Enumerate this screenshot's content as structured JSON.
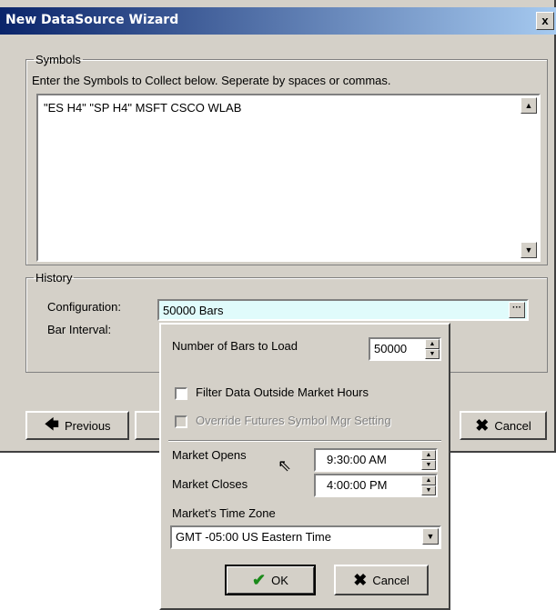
{
  "window": {
    "title": "New DataSource Wizard",
    "close_glyph": "x"
  },
  "symbols": {
    "legend": "Symbols",
    "instructions": "Enter the Symbols to Collect below.  Seperate by spaces or commas.",
    "value": "\"ES H4\" \"SP H4\" MSFT CSCO WLAB"
  },
  "history": {
    "legend": "History",
    "configuration_label": "Configuration:",
    "configuration_value": "50000 Bars",
    "bar_interval_label": "Bar Interval:"
  },
  "buttons": {
    "previous": "Previous",
    "cancel": "Cancel"
  },
  "popup": {
    "bars_label": "Number of Bars to Load",
    "bars_value": "50000",
    "filter_label": "Filter Data Outside Market Hours",
    "filter_checked": false,
    "override_label": "Override Futures Symbol Mgr Setting",
    "override_checked": false,
    "override_enabled": false,
    "market_opens_label": "Market Opens",
    "market_opens_value": "9:30:00 AM",
    "market_closes_label": "Market Closes",
    "market_closes_value": "4:00:00 PM",
    "timezone_label": "Market's Time Zone",
    "timezone_value": "GMT -05:00  US Eastern Time",
    "ok": "OK",
    "cancel": "Cancel"
  },
  "icons": {
    "close": "close-icon",
    "previous": "arrow-left-icon",
    "cancel": "x-icon",
    "ok": "check-icon"
  },
  "colors": {
    "title_gradient_start": "#0a246a",
    "title_gradient_end": "#a6caf0",
    "config_field_bg": "#e0fbfb",
    "face": "#d4d0c8"
  }
}
